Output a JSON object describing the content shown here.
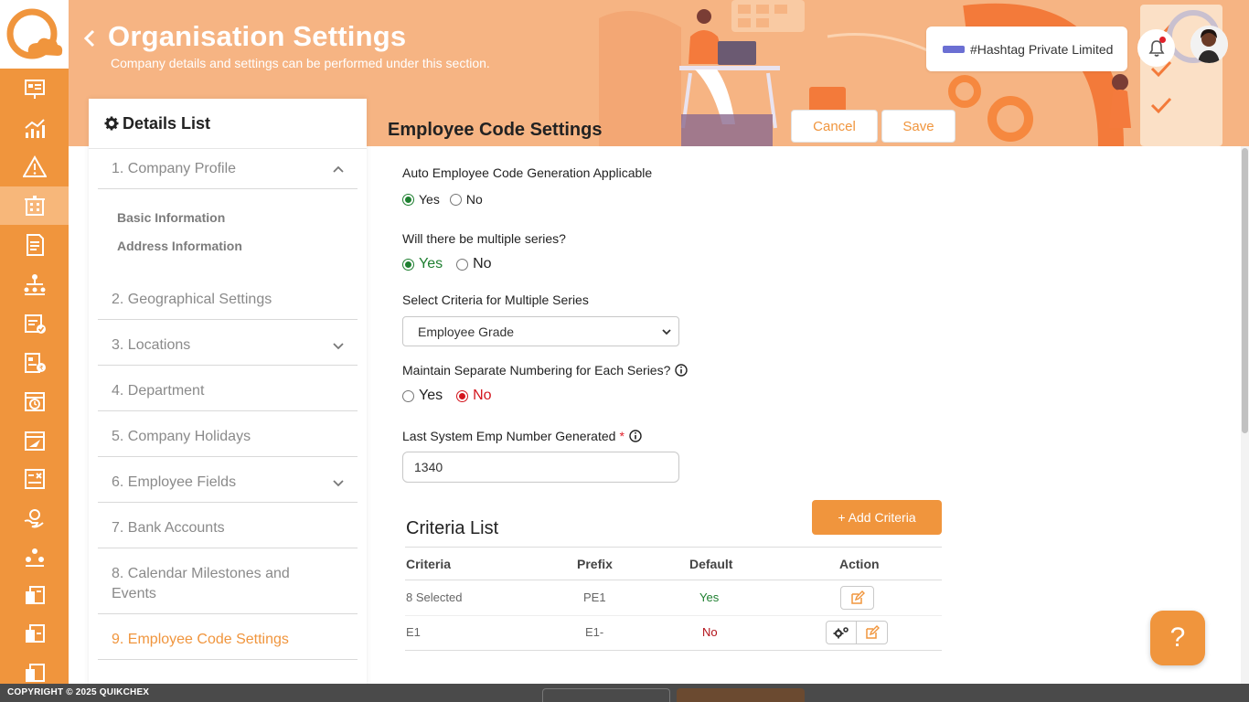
{
  "header": {
    "title": "Organisation Settings",
    "subtitle": "Company details and settings can be performed under this section.",
    "company_name": "#Hashtag Private Limited"
  },
  "colors": {
    "accent": "#f0953d",
    "banner": "#f6b483",
    "green": "#1e7f30",
    "red": "#d3141c"
  },
  "details": {
    "title": "Details List",
    "items": [
      {
        "label": "1. Company Profile"
      },
      {
        "label": "2. Geographical Settings"
      },
      {
        "label": "3. Locations"
      },
      {
        "label": "4. Department"
      },
      {
        "label": "5. Company Holidays"
      },
      {
        "label": "6. Employee Fields"
      },
      {
        "label": "7. Bank Accounts"
      },
      {
        "label": "8. Calendar Milestones and Events"
      },
      {
        "label": "9. Employee Code Settings"
      }
    ],
    "sub_items": [
      "Basic Information",
      "Address Information"
    ]
  },
  "main": {
    "section_title": "Employee Code Settings",
    "cancel_label": "Cancel",
    "save_label": "Save",
    "auto_code_label": "Auto Employee Code Generation Applicable",
    "multiple_series_label": "Will there be multiple series?",
    "criteria_select_label": "Select Criteria for Multiple Series",
    "criteria_select_value": "Employee Grade",
    "separate_numbering_label": "Maintain Separate Numbering for Each Series?",
    "last_emp_label": "Last System Emp Number Generated",
    "required_mark": "*",
    "last_emp_value": "1340",
    "yes": "Yes",
    "no": "No"
  },
  "criteria": {
    "title": "Criteria List",
    "add_label": "+ Add Criteria",
    "columns": [
      "Criteria",
      "Prefix",
      "Default",
      "Action"
    ],
    "rows": [
      {
        "criteria": "8 Selected",
        "prefix": "PE1",
        "default": "Yes"
      },
      {
        "criteria": "E1",
        "prefix": "E1-",
        "default": "No"
      }
    ]
  },
  "help_label": "?",
  "footer": {
    "copyright": "COPYRIGHT © 2025 QUIKCHEX"
  }
}
